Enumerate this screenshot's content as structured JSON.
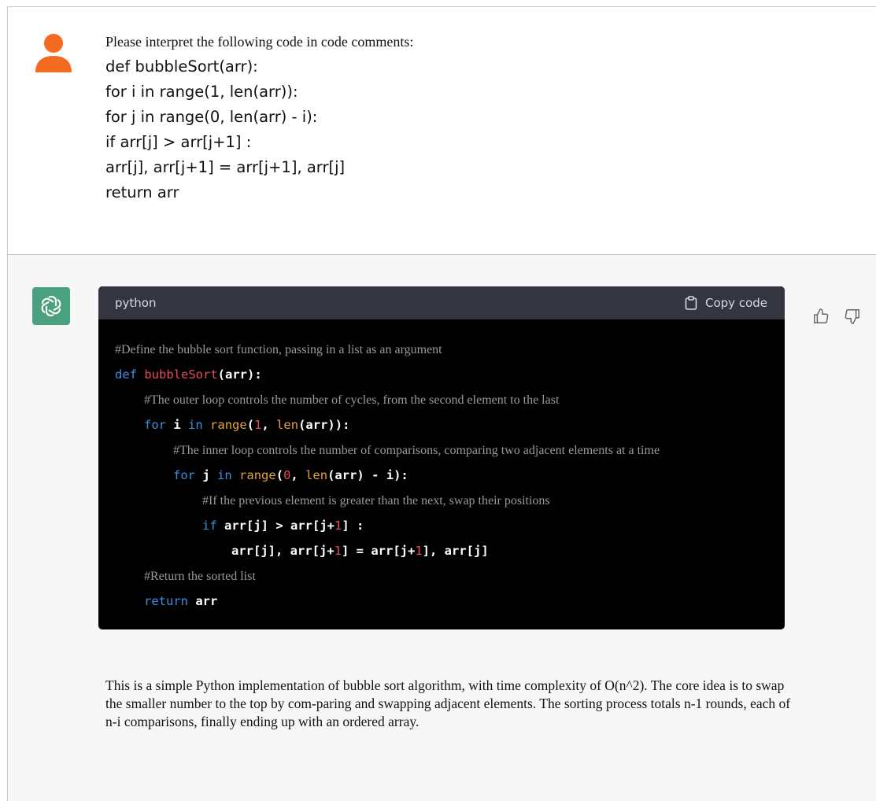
{
  "user": {
    "avatar_icon": "user-icon",
    "avatar_color": "#f26b21",
    "intro": "Please interpret the following code in code comments:",
    "code_lines": [
      "def bubbleSort(arr):",
      "for i in range(1, len(arr)):",
      "for j in range(0, len(arr) - i):",
      "if arr[j] > arr[j+1] :",
      "arr[j], arr[j+1] = arr[j+1], arr[j]",
      "return arr"
    ]
  },
  "assistant": {
    "avatar_icon": "openai-logo-icon",
    "avatar_color": "#4aa17f",
    "code_block": {
      "language": "python",
      "copy_label": "Copy code",
      "copy_icon": "clipboard-icon",
      "comments": {
        "define": "#Define the bubble sort function, passing in a list as an argument",
        "outer": "#The outer loop controls the number of cycles, from the second element to the last",
        "inner": "#The inner loop controls the number of comparisons, comparing two adjacent elements at a time",
        "compare": "#If the previous element is greater than the next, swap their positions",
        "ret": "#Return the sorted list"
      },
      "tokens": {
        "def": "def",
        "fn_name": "bubbleSort",
        "params": "(arr):",
        "for": "for",
        "in": "in",
        "range": "range",
        "len": "len",
        "if": "if",
        "return": "return",
        "i": "i",
        "j": "j",
        "one": "1",
        "zero": "0",
        "range1_open": "(",
        "range1_mid": ", ",
        "range1_close": "(arr)):",
        "range2_open": "(",
        "range2_mid": ", ",
        "range2_close": "(arr) - i):",
        "if_lhs": "arr[j] > arr[j+",
        "if_rhs": "] :",
        "swap_a": "arr[j], arr[j+",
        "swap_b": "] = arr[j+",
        "swap_c": "], arr[j]",
        "arr": "arr"
      }
    },
    "feedback": {
      "thumbs_up_icon": "thumbs-up-icon",
      "thumbs_down_icon": "thumbs-down-icon"
    },
    "explanation": "This is a simple Python implementation of bubble sort algorithm, with time complexity of O(n^2). The core idea is to swap the smaller number to the top by com-paring and swapping adjacent elements. The sorting process totals n-1 rounds, each of n-i comparisons, finally ending up with an ordered array."
  }
}
